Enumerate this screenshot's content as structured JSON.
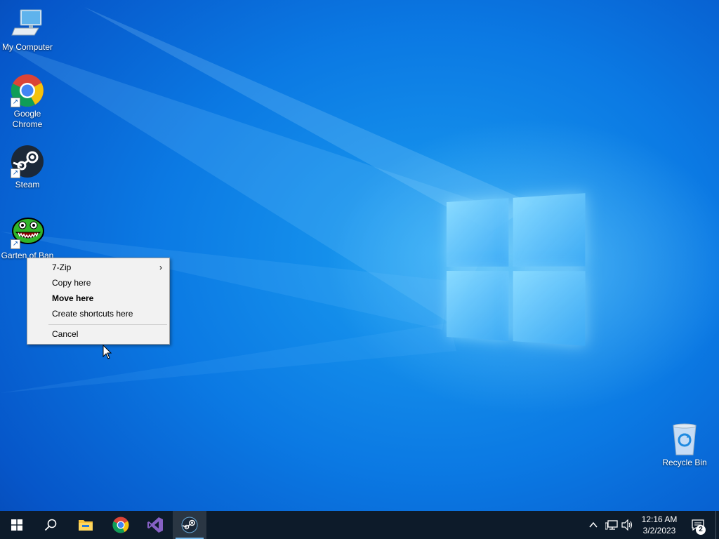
{
  "desktop": {
    "icons": [
      {
        "label": "My Computer",
        "icon": "computer-icon"
      },
      {
        "label": "Google Chrome",
        "icon": "chrome-icon"
      },
      {
        "label": "Steam",
        "icon": "steam-icon"
      },
      {
        "label": "Garten of Ban",
        "icon": "garten-of-banban-icon"
      },
      {
        "label": "Recycle Bin",
        "icon": "recycle-bin-icon"
      }
    ]
  },
  "context_menu": {
    "items": [
      {
        "label": "7-Zip",
        "has_submenu": true
      },
      {
        "label": "Copy here"
      },
      {
        "label": "Move here",
        "bold": true
      },
      {
        "label": "Create shortcuts here"
      },
      {
        "label": "Cancel"
      }
    ],
    "submenu_arrow": "›"
  },
  "taskbar": {
    "apps": [
      "start-icon",
      "search-icon",
      "file-explorer-icon",
      "chrome-icon",
      "visual-studio-icon",
      "steam-icon"
    ],
    "active_app": "steam-icon",
    "tray": [
      "chevron-up-icon",
      "network-icon",
      "volume-icon"
    ],
    "clock": {
      "time": "12:16 AM",
      "date": "3/2/2023"
    },
    "notifications": {
      "count": "2"
    }
  },
  "colors": {
    "taskbar": "#0d1b2a",
    "desktop_accent": "#0b79e3",
    "menu_bg": "#f2f2f2"
  }
}
